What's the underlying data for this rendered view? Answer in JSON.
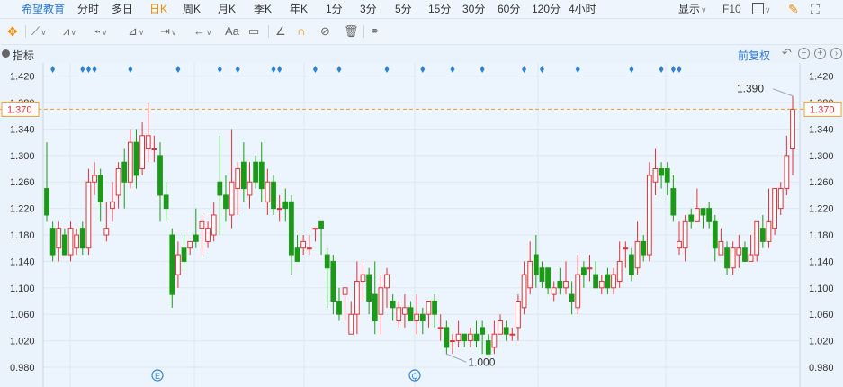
{
  "tabs": {
    "brand": "希望教育",
    "items": [
      "分时",
      "多日",
      "日K",
      "周K",
      "月K",
      "季K",
      "年K",
      "1分",
      "3分",
      "5分",
      "15分",
      "30分",
      "60分",
      "120分",
      "4小时"
    ],
    "active": "日K"
  },
  "top_right": {
    "display_label": "显示",
    "f10_label": "F10"
  },
  "indicator_bar": {
    "label": "指标",
    "adjust_label": "前复权"
  },
  "toolbar": {
    "text_tool": "Aa"
  },
  "colors": {
    "up": "#e0313b",
    "down": "#1a9a17",
    "marker": "#2b82d6",
    "ref_line": "#f0a030",
    "accent": "#f08a00"
  },
  "chart_data": {
    "type": "candlestick",
    "ylim": [
      0.95,
      1.44
    ],
    "y_ticks": [
      "1.420",
      "1.380",
      "1.340",
      "1.300",
      "1.260",
      "1.220",
      "1.180",
      "1.140",
      "1.100",
      "1.060",
      "1.020",
      "0.980"
    ],
    "current_price": "1.370",
    "annotations": {
      "high": "1.390",
      "low": "1.000"
    },
    "event_markers": [
      "E",
      "Q"
    ],
    "candles": [
      [
        1.25,
        1.21,
        1.32,
        1.2
      ],
      [
        1.19,
        1.15,
        1.2,
        1.14
      ],
      [
        1.16,
        1.19,
        1.2,
        1.14
      ],
      [
        1.18,
        1.15,
        1.19,
        1.15
      ],
      [
        1.15,
        1.19,
        1.2,
        1.14
      ],
      [
        1.16,
        1.18,
        1.19,
        1.15
      ],
      [
        1.19,
        1.16,
        1.2,
        1.15
      ],
      [
        1.16,
        1.26,
        1.28,
        1.15
      ],
      [
        1.26,
        1.27,
        1.29,
        1.24
      ],
      [
        1.27,
        1.23,
        1.28,
        1.2
      ],
      [
        1.18,
        1.19,
        1.23,
        1.17
      ],
      [
        1.22,
        1.23,
        1.26,
        1.2
      ],
      [
        1.24,
        1.28,
        1.29,
        1.22
      ],
      [
        1.29,
        1.26,
        1.31,
        1.22
      ],
      [
        1.26,
        1.32,
        1.34,
        1.25
      ],
      [
        1.32,
        1.27,
        1.34,
        1.25
      ],
      [
        1.28,
        1.33,
        1.35,
        1.27
      ],
      [
        1.31,
        1.33,
        1.38,
        1.29
      ],
      [
        1.31,
        1.31,
        1.33,
        1.29
      ],
      [
        1.3,
        1.24,
        1.32,
        1.2
      ],
      [
        1.24,
        1.22,
        1.26,
        1.2
      ],
      [
        1.18,
        1.09,
        1.19,
        1.07
      ],
      [
        1.12,
        1.15,
        1.17,
        1.1
      ],
      [
        1.16,
        1.14,
        1.18,
        1.13
      ],
      [
        1.16,
        1.17,
        1.17,
        1.15
      ],
      [
        1.18,
        1.17,
        1.22,
        1.16
      ],
      [
        1.19,
        1.2,
        1.21,
        1.15
      ],
      [
        1.17,
        1.19,
        1.2,
        1.16
      ],
      [
        1.18,
        1.21,
        1.23,
        1.17
      ],
      [
        1.26,
        1.24,
        1.33,
        1.18
      ],
      [
        1.24,
        1.22,
        1.27,
        1.2
      ],
      [
        1.21,
        1.26,
        1.34,
        1.19
      ],
      [
        1.25,
        1.28,
        1.29,
        1.21
      ],
      [
        1.29,
        1.25,
        1.32,
        1.23
      ],
      [
        1.24,
        1.26,
        1.29,
        1.22
      ],
      [
        1.29,
        1.26,
        1.3,
        1.25
      ],
      [
        1.29,
        1.25,
        1.32,
        1.23
      ],
      [
        1.23,
        1.26,
        1.28,
        1.21
      ],
      [
        1.26,
        1.22,
        1.27,
        1.21
      ],
      [
        1.22,
        1.22,
        1.24,
        1.2
      ],
      [
        1.23,
        1.22,
        1.25,
        1.2
      ],
      [
        1.23,
        1.15,
        1.24,
        1.12
      ],
      [
        1.16,
        1.14,
        1.18,
        1.14
      ],
      [
        1.16,
        1.17,
        1.18,
        1.15
      ],
      [
        1.16,
        1.16,
        1.18,
        1.15
      ],
      [
        1.19,
        1.19,
        1.19,
        1.17
      ],
      [
        1.2,
        1.19,
        1.2,
        1.15
      ],
      [
        1.15,
        1.13,
        1.16,
        1.07
      ],
      [
        1.14,
        1.08,
        1.15,
        1.06
      ],
      [
        1.08,
        1.06,
        1.1,
        1.05
      ],
      [
        1.09,
        1.1,
        1.1,
        1.05
      ],
      [
        1.03,
        1.06,
        1.08,
        1.03
      ],
      [
        1.06,
        1.11,
        1.14,
        1.03
      ],
      [
        1.11,
        1.12,
        1.14,
        1.08
      ],
      [
        1.12,
        1.08,
        1.13,
        1.06
      ],
      [
        1.09,
        1.05,
        1.14,
        1.03
      ],
      [
        1.06,
        1.1,
        1.12,
        1.03
      ],
      [
        1.1,
        1.12,
        1.13,
        1.07
      ],
      [
        1.08,
        1.07,
        1.09,
        1.05
      ],
      [
        1.05,
        1.07,
        1.08,
        1.04
      ],
      [
        1.06,
        1.07,
        1.09,
        1.04
      ],
      [
        1.07,
        1.05,
        1.08,
        1.05
      ],
      [
        1.05,
        1.06,
        1.09,
        1.03
      ],
      [
        1.06,
        1.05,
        1.07,
        1.03
      ],
      [
        1.06,
        1.08,
        1.08,
        1.04
      ],
      [
        1.08,
        1.06,
        1.09,
        1.04
      ],
      [
        1.04,
        1.04,
        1.06,
        1.02
      ],
      [
        1.04,
        1.01,
        1.05,
        1.0
      ],
      [
        1.02,
        1.02,
        1.03,
        1.0
      ],
      [
        1.02,
        1.03,
        1.05,
        1.01
      ],
      [
        1.03,
        1.02,
        1.03,
        1.01
      ],
      [
        1.02,
        1.03,
        1.04,
        1.01
      ],
      [
        1.03,
        1.02,
        1.05,
        1.01
      ],
      [
        1.04,
        1.03,
        1.05,
        1.0
      ],
      [
        1.02,
        1.0,
        1.03,
        1.0
      ],
      [
        1.01,
        1.03,
        1.05,
        1.0
      ],
      [
        1.03,
        1.05,
        1.06,
        1.03
      ],
      [
        1.04,
        1.03,
        1.05,
        1.02
      ],
      [
        1.03,
        1.03,
        1.04,
        1.02
      ],
      [
        1.04,
        1.08,
        1.09,
        1.02
      ],
      [
        1.07,
        1.12,
        1.14,
        1.06
      ],
      [
        1.1,
        1.14,
        1.17,
        1.09
      ],
      [
        1.15,
        1.12,
        1.18,
        1.1
      ],
      [
        1.13,
        1.11,
        1.14,
        1.1
      ],
      [
        1.13,
        1.1,
        1.13,
        1.09
      ],
      [
        1.09,
        1.1,
        1.11,
        1.08
      ],
      [
        1.11,
        1.1,
        1.13,
        1.09
      ],
      [
        1.1,
        1.11,
        1.14,
        1.09
      ],
      [
        1.09,
        1.08,
        1.11,
        1.06
      ],
      [
        1.07,
        1.12,
        1.15,
        1.06
      ],
      [
        1.13,
        1.12,
        1.14,
        1.1
      ],
      [
        1.13,
        1.13,
        1.15,
        1.11
      ],
      [
        1.12,
        1.1,
        1.14,
        1.1
      ],
      [
        1.1,
        1.11,
        1.12,
        1.09
      ],
      [
        1.12,
        1.1,
        1.13,
        1.09
      ],
      [
        1.1,
        1.12,
        1.13,
        1.09
      ],
      [
        1.11,
        1.14,
        1.17,
        1.1
      ],
      [
        1.16,
        1.16,
        1.17,
        1.13
      ],
      [
        1.15,
        1.12,
        1.16,
        1.11
      ],
      [
        1.13,
        1.17,
        1.2,
        1.12
      ],
      [
        1.17,
        1.15,
        1.18,
        1.14
      ],
      [
        1.15,
        1.27,
        1.29,
        1.14
      ],
      [
        1.26,
        1.28,
        1.31,
        1.24
      ],
      [
        1.28,
        1.27,
        1.29,
        1.25
      ],
      [
        1.28,
        1.26,
        1.29,
        1.24
      ],
      [
        1.25,
        1.21,
        1.27,
        1.2
      ],
      [
        1.16,
        1.17,
        1.2,
        1.15
      ],
      [
        1.16,
        1.2,
        1.21,
        1.14
      ],
      [
        1.21,
        1.2,
        1.22,
        1.19
      ],
      [
        1.2,
        1.22,
        1.25,
        1.2
      ],
      [
        1.22,
        1.21,
        1.22,
        1.19
      ],
      [
        1.22,
        1.2,
        1.23,
        1.19
      ],
      [
        1.2,
        1.16,
        1.21,
        1.14
      ],
      [
        1.15,
        1.17,
        1.19,
        1.15
      ],
      [
        1.16,
        1.13,
        1.17,
        1.12
      ],
      [
        1.13,
        1.16,
        1.17,
        1.12
      ],
      [
        1.15,
        1.16,
        1.18,
        1.13
      ],
      [
        1.16,
        1.14,
        1.17,
        1.14
      ],
      [
        1.14,
        1.15,
        1.18,
        1.14
      ],
      [
        1.15,
        1.2,
        1.2,
        1.14
      ],
      [
        1.19,
        1.17,
        1.21,
        1.16
      ],
      [
        1.17,
        1.2,
        1.25,
        1.16
      ],
      [
        1.19,
        1.25,
        1.25,
        1.18
      ],
      [
        1.22,
        1.25,
        1.26,
        1.21
      ],
      [
        1.25,
        1.3,
        1.33,
        1.24
      ],
      [
        1.31,
        1.37,
        1.39,
        1.27
      ]
    ],
    "markers": [
      1,
      6,
      7,
      8,
      14,
      22,
      29,
      32,
      38,
      39,
      45,
      49,
      57,
      63,
      68,
      73,
      80,
      83,
      89,
      98,
      103,
      105,
      106
    ]
  }
}
